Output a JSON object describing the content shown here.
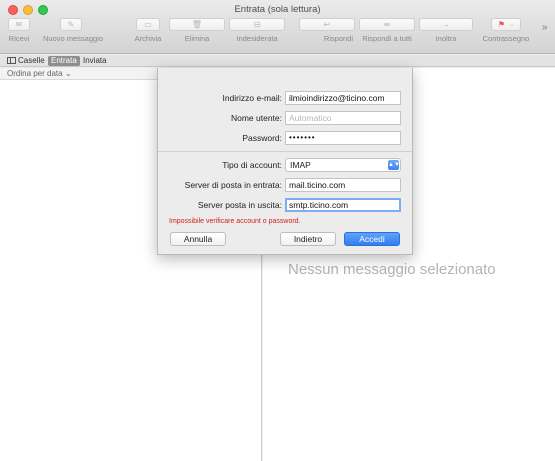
{
  "window": {
    "title": "Entrata (sola lettura)"
  },
  "toolbar": {
    "items": [
      {
        "label": "Ricevi",
        "icon": "inbox-tray-icon",
        "glyph": "✉"
      },
      {
        "label": "Nuovo messaggio",
        "icon": "compose-icon",
        "glyph": "✎"
      },
      {
        "label": "Archivia",
        "icon": "archive-box-icon",
        "glyph": "▭"
      },
      {
        "label": "Elimina",
        "icon": "trash-icon",
        "glyph": "🗑"
      },
      {
        "label": "Indesiderata",
        "icon": "junk-icon",
        "glyph": "⊟"
      },
      {
        "label": "Rispondi",
        "icon": "reply-icon",
        "glyph": "↩"
      },
      {
        "label": "Rispondi a tutti",
        "icon": "reply-all-icon",
        "glyph": "⇚"
      },
      {
        "label": "Inoltra",
        "icon": "forward-icon",
        "glyph": "→"
      },
      {
        "label": "Contrassegno",
        "icon": "flag-icon",
        "glyph": "⚑"
      }
    ],
    "overflow_glyph": "»"
  },
  "favorites": {
    "mailboxes": "Caselle",
    "inbox": "Entrata",
    "sent": "Inviata"
  },
  "list": {
    "sort_label": "Ordina per data ⌄"
  },
  "viewer": {
    "empty_text": "Nessun messaggio selezionato"
  },
  "sheet": {
    "email": {
      "label": "Indirizzo e-mail:",
      "value": "ilmioindirizzo@ticino.com"
    },
    "username": {
      "label": "Nome utente:",
      "placeholder": "Automatico"
    },
    "password": {
      "label": "Password:",
      "value": "•••••••"
    },
    "account_type": {
      "label": "Tipo di account:",
      "value": "IMAP"
    },
    "incoming": {
      "label": "Server di posta in entrata:",
      "value": "mail.ticino.com"
    },
    "outgoing": {
      "label": "Server posta in uscita:",
      "value": "smtp.ticino.com"
    },
    "error": "Impossibile verificare account o password.",
    "buttons": {
      "cancel": "Annulla",
      "back": "Indietro",
      "signin": "Accedi"
    }
  },
  "colors": {
    "accent": "#3c84ef",
    "error": "#d11d1d",
    "flag": "#f0505a"
  }
}
